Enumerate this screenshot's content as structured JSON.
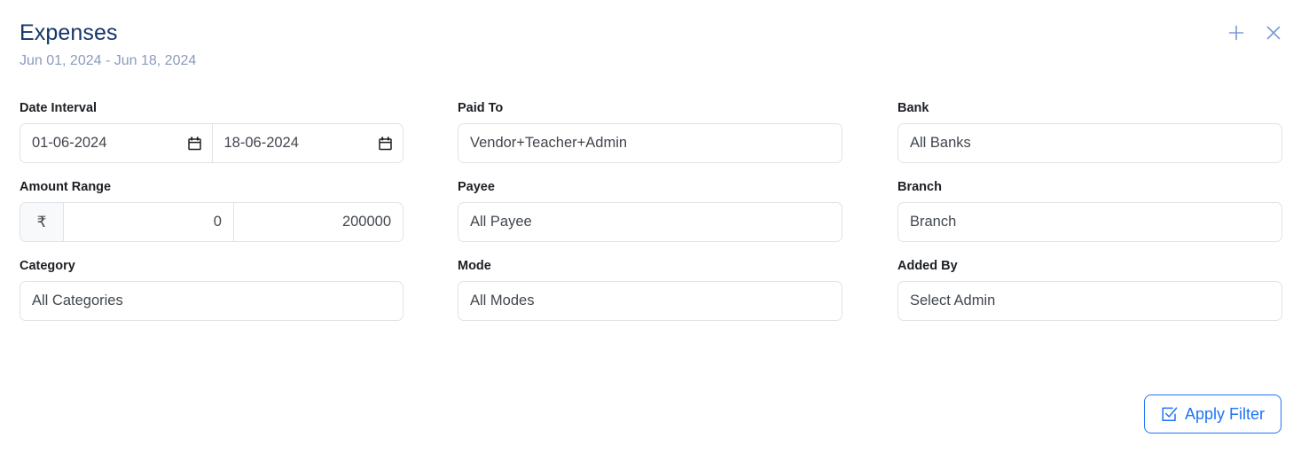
{
  "header": {
    "title": "Expenses",
    "date_range": "Jun 01, 2024 - Jun 18, 2024",
    "add_icon": "plus-icon",
    "close_icon": "close-icon",
    "accent_color": "#7a9ad4",
    "title_color": "#14366b",
    "subtitle_color": "#8b9bbb"
  },
  "form": {
    "columns": [
      {
        "fields": [
          {
            "label": "Date Interval",
            "type": "date-range",
            "from_value": "01-06-2024",
            "to_value": "18-06-2024",
            "icon": "calendar-icon"
          },
          {
            "label": "Amount Range",
            "type": "amount-range",
            "currency_symbol": "₹",
            "min_value": "0",
            "max_value": "200000"
          },
          {
            "label": "Category",
            "type": "select",
            "value": "All Categories"
          }
        ]
      },
      {
        "fields": [
          {
            "label": "Paid To",
            "type": "select",
            "value": "Vendor+Teacher+Admin"
          },
          {
            "label": "Payee",
            "type": "select",
            "value": "All Payee"
          },
          {
            "label": "Mode",
            "type": "select",
            "value": "All Modes"
          }
        ]
      },
      {
        "fields": [
          {
            "label": "Bank",
            "type": "select",
            "value": "All Banks"
          },
          {
            "label": "Branch",
            "type": "select",
            "value": "Branch"
          },
          {
            "label": "Added By",
            "type": "select",
            "value": "Select Admin"
          }
        ]
      }
    ]
  },
  "footer": {
    "apply_label": "Apply Filter",
    "apply_icon": "checkbox-check-icon",
    "apply_color": "#1d74f5"
  }
}
